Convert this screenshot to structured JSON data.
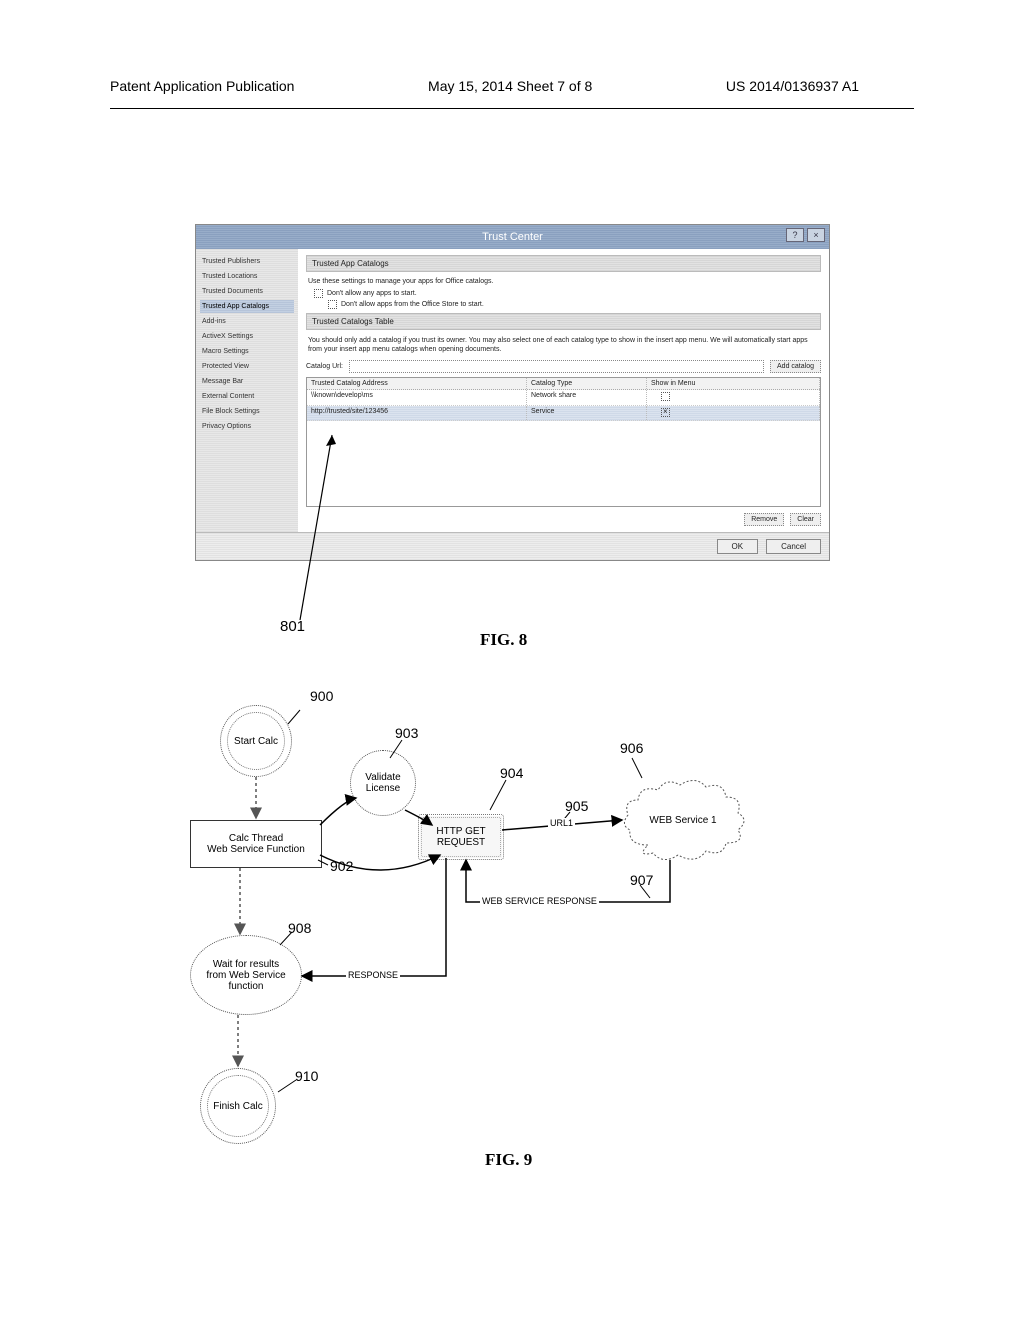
{
  "header": {
    "left": "Patent Application Publication",
    "center": "May 15, 2014  Sheet 7 of 8",
    "right": "US 2014/0136937 A1"
  },
  "fig8": {
    "title": "Trust Center",
    "help_btn": "?",
    "close_btn": "×",
    "sidebar": {
      "items": [
        "Trusted Publishers",
        "Trusted Locations",
        "Trusted Documents",
        "Trusted App Catalogs",
        "Add-ins",
        "ActiveX Settings",
        "Macro Settings",
        "Protected View",
        "Message Bar",
        "External Content",
        "File Block Settings",
        "Privacy Options"
      ],
      "selected_index": 3
    },
    "section1": {
      "heading": "Trusted App Catalogs",
      "desc": "Use these settings to manage your apps for Office catalogs.",
      "chk1": "Don't allow any apps to start.",
      "chk2": "Don't allow apps from the Office Store to start."
    },
    "section2": {
      "heading": "Trusted Catalogs Table",
      "desc": "You should only add a catalog if you trust its owner. You may also select one of each catalog type to show in the insert app menu. We will automatically start apps from your insert app menu catalogs when opening documents.",
      "url_label": "Catalog Url:",
      "add_btn": "Add catalog",
      "columns": [
        "Trusted Catalog Address",
        "Catalog Type",
        "Show in Menu"
      ],
      "rows": [
        {
          "addr": "\\\\known\\develop\\ms",
          "type": "Network share",
          "show": false,
          "selected": false
        },
        {
          "addr": "http://trusted/site/123456",
          "type": "Service",
          "show": true,
          "selected": true
        }
      ],
      "remove": "Remove",
      "clear": "Clear"
    },
    "footer": {
      "ok": "OK",
      "cancel": "Cancel"
    },
    "ref_num": "801",
    "caption": "FIG. 8"
  },
  "fig9": {
    "nodes": {
      "start": "Start Calc",
      "calc_thread": "Calc Thread\nWeb Service Function",
      "validate": "Validate\nLicense",
      "http_get": "HTTP GET\nREQUEST",
      "wait": "Wait for results\nfrom Web Service\nfunction",
      "finish": "Finish Calc",
      "web_service": "WEB Service 1"
    },
    "edges": {
      "url1": "URL1",
      "response": "RESPONSE",
      "web_response": "WEB SERVICE RESPONSE"
    },
    "nums": {
      "n900": "900",
      "n902": "902",
      "n903": "903",
      "n904": "904",
      "n905": "905",
      "n906": "906",
      "n907": "907",
      "n908": "908",
      "n910": "910"
    },
    "caption": "FIG. 9"
  }
}
